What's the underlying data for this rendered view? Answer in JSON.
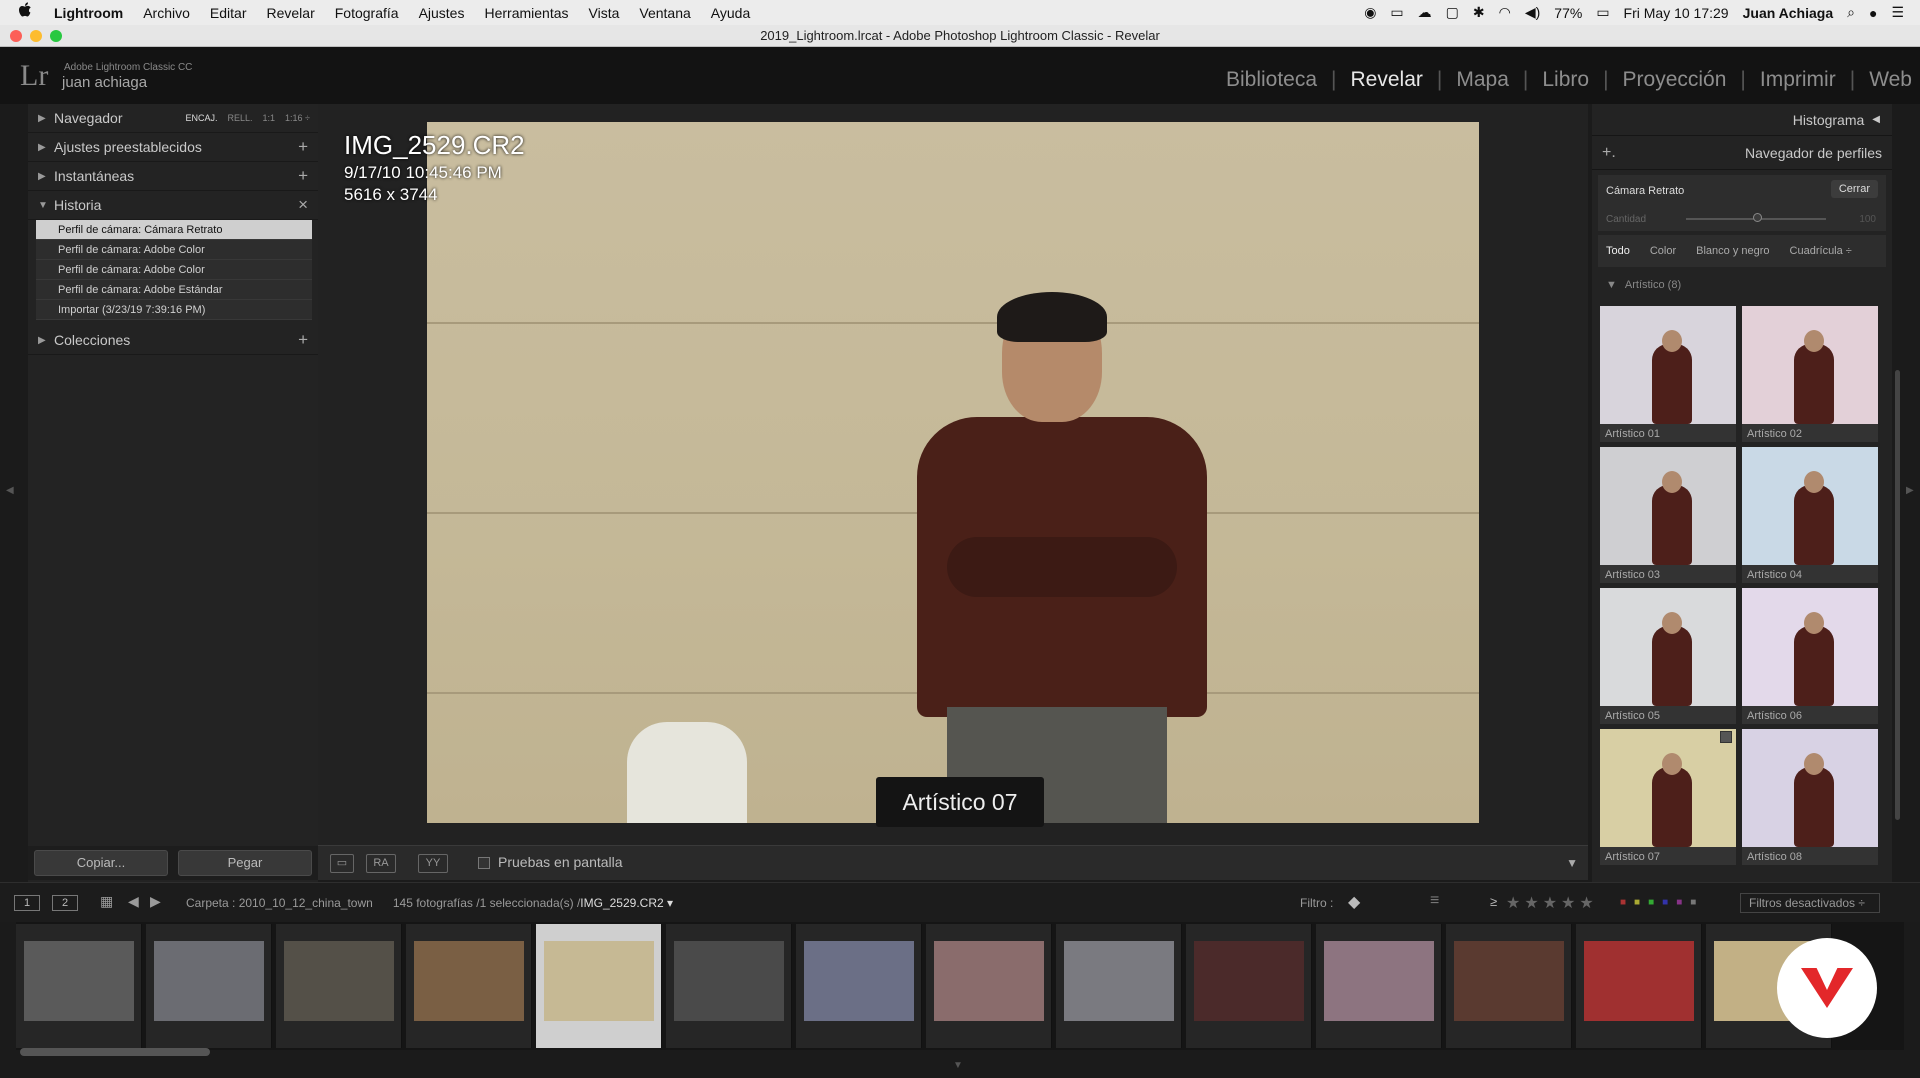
{
  "menubar": {
    "apple": "",
    "app": "Lightroom",
    "items": [
      "Archivo",
      "Editar",
      "Revelar",
      "Fotografía",
      "Ajustes",
      "Herramientas",
      "Vista",
      "Ventana",
      "Ayuda"
    ],
    "battery": "77%",
    "datetime": "Fri May 10  17:29",
    "user": "Juan Achiaga"
  },
  "window": {
    "title": "2019_Lightroom.lrcat - Adobe Photoshop Lightroom Classic - Revelar"
  },
  "identity": {
    "logo": "Lr",
    "line1": "Adobe Lightroom Classic CC",
    "line2": "juan achiaga"
  },
  "modules": [
    "Biblioteca",
    "Revelar",
    "Mapa",
    "Libro",
    "Proyección",
    "Imprimir",
    "Web"
  ],
  "active_module": "Revelar",
  "left": {
    "navegador": "Navegador",
    "nav_opts": [
      "ENCAJ.",
      "RELL.",
      "1:1",
      "1:16 ÷"
    ],
    "presets": "Ajustes preestablecidos",
    "snapshots": "Instantáneas",
    "history": "Historia",
    "history_items": [
      "Perfil de cámara: Cámara Retrato",
      "Perfil de cámara: Adobe Color",
      "Perfil de cámara: Adobe Color",
      "Perfil de cámara: Adobe Estándar",
      "Importar (3/23/19 7:39:16 PM)"
    ],
    "collections": "Colecciones",
    "copy": "Copiar...",
    "paste": "Pegar"
  },
  "photo": {
    "filename": "IMG_2529.CR2",
    "datetime": "9/17/10 10:45:46 PM",
    "dims": "5616 x 3744",
    "toast": "Artístico 07"
  },
  "toolbar": {
    "ya": "YY",
    "ra": "RA",
    "proof": "Pruebas en pantalla"
  },
  "right": {
    "histogram": "Histograma",
    "browser": "Navegador de perfiles",
    "camera_profile": "Cámara Retrato",
    "close": "Cerrar",
    "amount": "Cantidad",
    "amount_val": "100",
    "filters": [
      "Todo",
      "Color",
      "Blanco y negro",
      "Cuadrícula ÷"
    ],
    "group": "Artístico (8)",
    "profiles": [
      "Artístico 01",
      "Artístico 02",
      "Artístico 03",
      "Artístico 04",
      "Artístico 05",
      "Artístico 06",
      "Artístico 07",
      "Artístico 08"
    ],
    "tints": [
      "#d8d4dc",
      "#e3d0d8",
      "#cfcfd2",
      "#c9d9e6",
      "#d9dadc",
      "#e3d9ea",
      "#d8cfa4",
      "#d8d2e4"
    ]
  },
  "filmstrip": {
    "m1": "1",
    "m2": "2",
    "folder": "Carpeta : 2010_10_12_china_town",
    "count": "145 fotografías /1 seleccionada(s) /",
    "current": "IMG_2529.CR2 ▾",
    "filter": "Filtro :",
    "ge": "≥",
    "stars": "★★★★★",
    "filters_off": "Filtros desactivados ÷",
    "thumbs": [
      "#5a5a5a",
      "#6b6c72",
      "#545048",
      "#7a5f44",
      "#c6b994",
      "#4a4a4a",
      "#6b6f86",
      "#8a6c6c",
      "#7a7a80",
      "#4b2a2a",
      "#8d7480",
      "#5a3a30",
      "#a03030",
      "#c2b085"
    ]
  },
  "colors": {
    "accent": "#e3272a",
    "selected_history": "#cfcfcf"
  }
}
